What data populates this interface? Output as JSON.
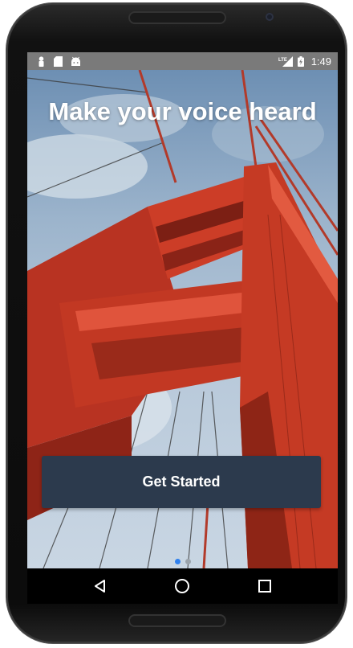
{
  "status_bar": {
    "time": "1:49",
    "network": "LTE",
    "left_icons": [
      "person-icon",
      "sd-card-icon",
      "android-icon"
    ]
  },
  "onboarding": {
    "headline": "Make your voice heard",
    "cta_label": "Get Started",
    "pages_total": 2,
    "current_page": 1
  },
  "nav_bar": {
    "buttons": [
      "back-icon",
      "home-icon",
      "recents-icon"
    ]
  },
  "colors": {
    "cta_background": "#2c3a4d",
    "active_dot": "#2f80ed",
    "inactive_dot": "#9aa3ab",
    "status_bar": "#7a7a7a",
    "bridge_red": "#c93a22"
  }
}
